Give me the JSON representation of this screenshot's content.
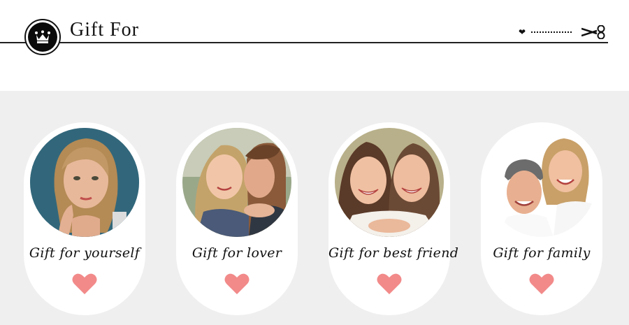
{
  "header": {
    "title": "Gift For",
    "crown_icon": "crown-icon",
    "heart_icon": "heart-icon",
    "scissors_icon": "scissors-icon"
  },
  "colors": {
    "panel_bg": "#efefef",
    "heart": "#f28a8a",
    "text": "#111111"
  },
  "cards": [
    {
      "label": "Gift for yourself",
      "photo": "portrait-woman-photo"
    },
    {
      "label": "Gift for lover",
      "photo": "couple-photo"
    },
    {
      "label": "Gift for best friend",
      "photo": "best-friends-photo"
    },
    {
      "label": "Gift for family",
      "photo": "parents-photo"
    }
  ]
}
